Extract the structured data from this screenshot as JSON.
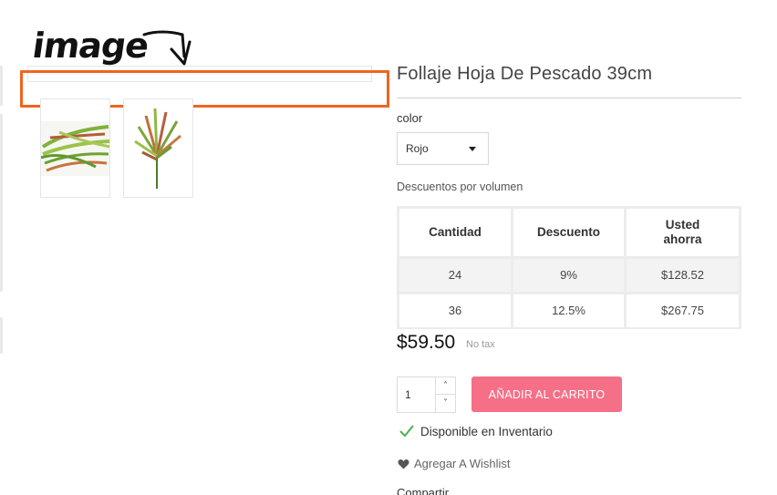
{
  "annotation": {
    "text": "image"
  },
  "product": {
    "title": "Follaje Hoja De Pescado 39cm",
    "color_label": "color",
    "color_selected": "Rojo",
    "discounts_label": "Descuentos por volumen",
    "discount_table": {
      "headers": [
        "Cantidad",
        "Descuento",
        "Usted ahorra"
      ],
      "rows": [
        [
          "24",
          "9%",
          "$128.52"
        ],
        [
          "36",
          "12.5%",
          "$267.75"
        ]
      ]
    },
    "price": "$59.50",
    "tax_note": "No tax",
    "quantity": "1",
    "add_to_cart_label": "AÑADIR AL CARRITO",
    "stock_status": "Disponible en Inventario",
    "wishlist_label": "Agregar A Wishlist",
    "share_label": "Compartir"
  },
  "colors": {
    "accent_button": "#f56f86",
    "highlight_box": "#f0641f",
    "check": "#4caf50"
  },
  "icons": [
    "chevron-up-icon",
    "chevron-down-icon",
    "caret-down-icon",
    "check-icon",
    "heart-icon",
    "arrow-icon"
  ]
}
